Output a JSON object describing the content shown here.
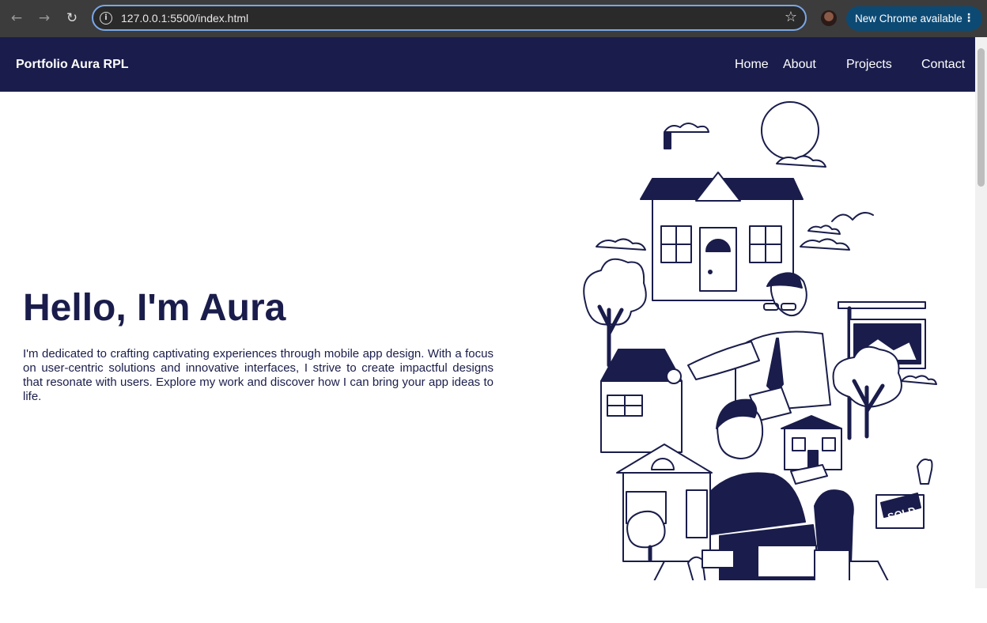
{
  "browser": {
    "url": "127.0.0.1:5500/index.html",
    "update_label": "New Chrome available",
    "back_icon": "←",
    "forward_icon": "→",
    "reload_icon": "↻",
    "star_icon": "☆",
    "menu_icon": "⋮",
    "info_icon": "i"
  },
  "nav": {
    "brand": "Portfolio Aura RPL",
    "links": [
      "Home",
      "About",
      "Projects",
      "Contact"
    ]
  },
  "hero": {
    "title": "Hello, I'm Aura",
    "text": "I'm dedicated to crafting captivating experiences through mobile app design. With a focus on user-centric solutions and innovative interfaces, I strive to create impactful designs that resonate with users. Explore my work and discover how I can bring your app ideas to life.",
    "illustration_sign": "SOLD"
  },
  "colors": {
    "navy": "#1a1d4b",
    "chrome_bg": "#3c3c3c",
    "accent_blue": "#7aa7e8",
    "update_pill": "#0c4a74"
  }
}
